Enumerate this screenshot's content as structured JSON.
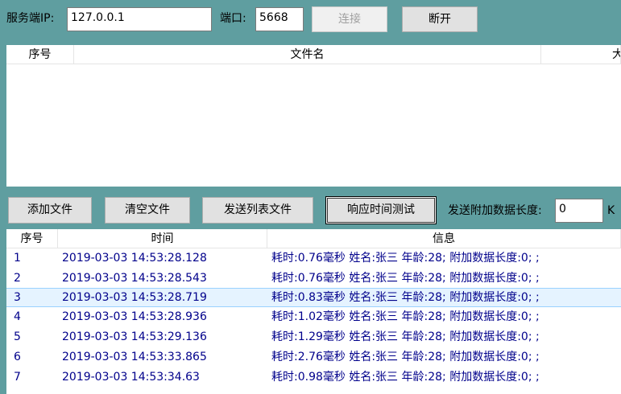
{
  "connection": {
    "server_ip_label": "服务端IP:",
    "server_ip_value": "127.0.0.1",
    "port_label": "端口:",
    "port_value": "5668",
    "connect_label": "连接",
    "disconnect_label": "断开"
  },
  "file_list": {
    "columns": [
      "序号",
      "文件名",
      "大"
    ]
  },
  "toolbar": {
    "add_file_label": "添加文件",
    "clear_file_label": "清空文件",
    "send_list_label": "发送列表文件",
    "response_test_label": "响应时间测试",
    "extra_len_label": "发送附加数据长度:",
    "extra_len_value": "0",
    "unit_label": "K"
  },
  "log_list": {
    "columns": [
      "序号",
      "时间",
      "信息"
    ],
    "rows": [
      {
        "id": "1",
        "time": "2019-03-03 14:53:28.128",
        "info": "耗时:0.76毫秒 姓名:张三 年龄:28; 附加数据长度:0; ;"
      },
      {
        "id": "2",
        "time": "2019-03-03 14:53:28.543",
        "info": "耗时:0.76毫秒 姓名:张三 年龄:28; 附加数据长度:0; ;"
      },
      {
        "id": "3",
        "time": "2019-03-03 14:53:28.719",
        "info": "耗时:0.83毫秒 姓名:张三 年龄:28; 附加数据长度:0; ;"
      },
      {
        "id": "4",
        "time": "2019-03-03 14:53:28.936",
        "info": "耗时:1.02毫秒 姓名:张三 年龄:28; 附加数据长度:0; ;"
      },
      {
        "id": "5",
        "time": "2019-03-03 14:53:29.136",
        "info": "耗时:1.29毫秒 姓名:张三 年龄:28; 附加数据长度:0; ;"
      },
      {
        "id": "6",
        "time": "2019-03-03 14:53:33.865",
        "info": "耗时:2.76毫秒 姓名:张三 年龄:28; 附加数据长度:0; ;"
      },
      {
        "id": "7",
        "time": "2019-03-03 14:53:34.63",
        "info": "耗时:0.98毫秒 姓名:张三 年龄:28; 附加数据长度:0; ;"
      }
    ],
    "selected_row": 2
  },
  "colors": {
    "background": "#5f9ea0",
    "row_text": "#00008b",
    "selection": "#e5f3ff"
  }
}
